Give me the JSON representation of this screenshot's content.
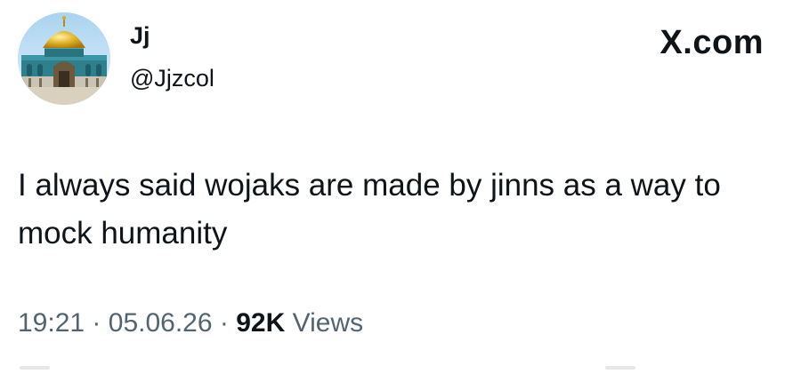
{
  "tweet": {
    "author": {
      "display_name": "Jj",
      "handle": "@Jjzcol",
      "avatar_icon": "dome-of-the-rock-avatar"
    },
    "brand_label": "X.com",
    "text": "I always said wojaks are made by jinns as a way to mock humanity",
    "time": "19:21",
    "date": "05.06.26",
    "separator": "·",
    "views_count": "92K",
    "views_label": "Views"
  },
  "colors": {
    "text_primary": "#0f1419",
    "text_secondary": "#536471",
    "background": "#ffffff"
  }
}
